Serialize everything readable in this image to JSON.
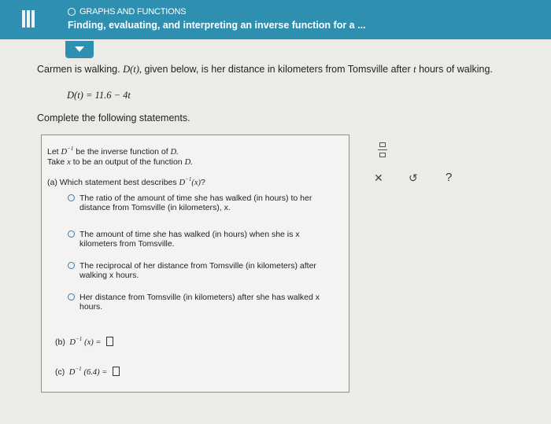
{
  "header": {
    "topic": "GRAPHS AND FUNCTIONS",
    "title": "Finding, evaluating, and interpreting an inverse function for a ..."
  },
  "problem": {
    "intro_prefix": "Carmen is walking.",
    "intro_fn": "D(t),",
    "intro_mid": "given below, is her distance in kilometers from Tomsville after",
    "intro_var": "t",
    "intro_suffix": "hours of walking.",
    "formula": "D(t) = 11.6 − 4t",
    "complete": "Complete the following statements."
  },
  "panel": {
    "let_line_1a": "Let",
    "let_line_1b": "be the inverse function of",
    "let_line_1c": "D.",
    "let_line_2a": "Take",
    "let_line_2b": "x",
    "let_line_2c": "to be an output of the function",
    "let_line_2d": "D.",
    "question_a_prefix": "(a)  Which statement best describes",
    "question_a_suffix": "?",
    "options": [
      {
        "line1": "The ratio of the amount of time she has walked (in hours) to her",
        "line2": "distance from Tomsville (in kilometers), x."
      },
      {
        "line1": "The amount of time she has walked (in hours) when she is x",
        "line2": "kilometers from Tomsville."
      },
      {
        "line1": "The reciprocal of her distance from Tomsville (in kilometers) after",
        "line2": "walking x hours."
      },
      {
        "line1": "Her distance from Tomsville (in kilometers) after she has walked x",
        "line2": "hours."
      }
    ],
    "part_b_label": "(b)",
    "part_b_expr": "(x)  =",
    "part_c_label": "(c)",
    "part_c_expr": "(6.4)  ="
  },
  "icons": {
    "menu": "hamburger-menu-icon",
    "collapse": "chevron-down-icon",
    "fraction": "fraction-icon",
    "clear": "close-icon",
    "undo": "undo-icon",
    "help": "help-icon"
  },
  "colors": {
    "header": "#2f8fb0",
    "background": "#ecebe8",
    "panel": "#f4f3f1",
    "radio": "#3a7ea0"
  }
}
